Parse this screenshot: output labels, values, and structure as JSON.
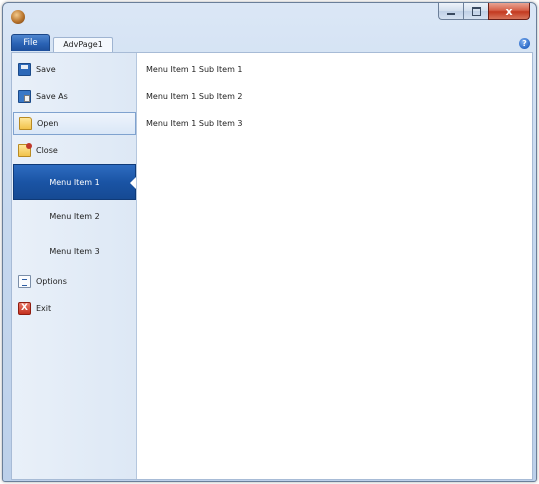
{
  "window": {
    "app_icon": "app-globe-icon",
    "controls": {
      "minimize_icon": "minimize-icon",
      "maximize_icon": "maximize-icon",
      "close_glyph": "x"
    }
  },
  "ribbon": {
    "file_tab": "File",
    "tabs": [
      {
        "label": "AdvPage1"
      }
    ],
    "help_glyph": "?"
  },
  "backstage": {
    "commands_top": [
      {
        "label": "Save",
        "icon": "save-icon"
      },
      {
        "label": "Save As",
        "icon": "save-as-icon"
      },
      {
        "label": "Open",
        "icon": "open-folder-icon"
      },
      {
        "label": "Close",
        "icon": "close-folder-icon"
      }
    ],
    "menu_items": [
      {
        "label": "Menu Item 1",
        "selected": true
      },
      {
        "label": "Menu Item 2",
        "selected": false
      },
      {
        "label": "Menu Item 3",
        "selected": false
      }
    ],
    "commands_bottom": [
      {
        "label": "Options",
        "icon": "options-icon"
      },
      {
        "label": "Exit",
        "icon": "exit-icon",
        "glyph": "X"
      }
    ],
    "content": {
      "sub_items": [
        {
          "label": "Menu Item 1 Sub Item 1"
        },
        {
          "label": "Menu Item 1 Sub Item 2"
        },
        {
          "label": "Menu Item 1 Sub Item 3"
        }
      ]
    }
  },
  "colors": {
    "file_tab": "#2a62b4",
    "selected_item": "#1a54a5",
    "close_button": "#c3391f"
  }
}
